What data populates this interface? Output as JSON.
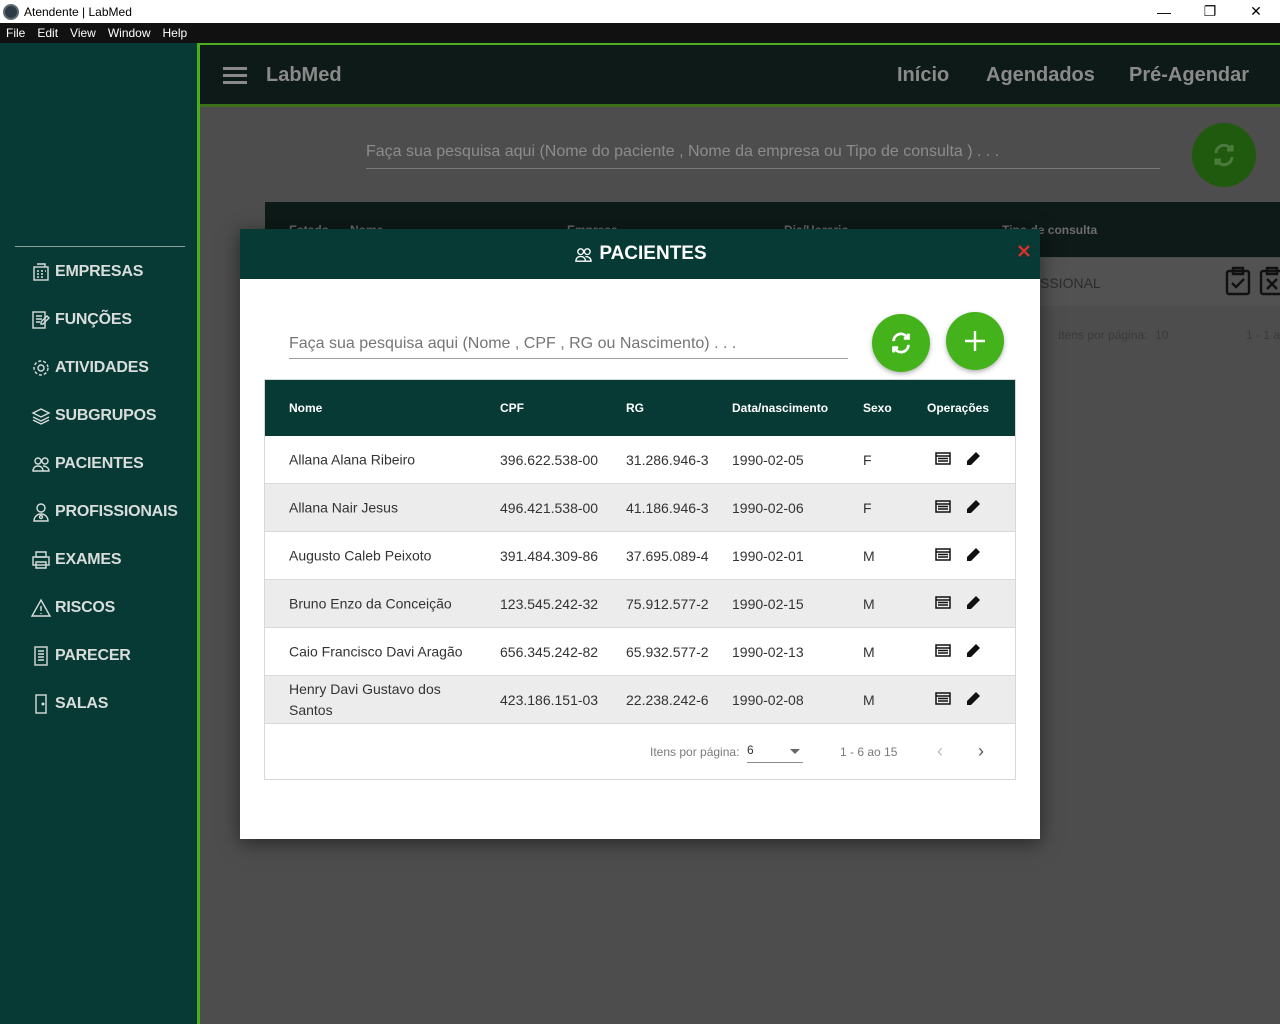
{
  "window": {
    "title": "Atendente | LabMed",
    "minimize": "—",
    "maximize": "❐",
    "close": "✕"
  },
  "menubar": [
    "File",
    "Edit",
    "View",
    "Window",
    "Help"
  ],
  "sidebar": {
    "items": [
      {
        "label": "EMPRESAS",
        "icon": "building-icon"
      },
      {
        "label": "FUNÇÕES",
        "icon": "document-edit-icon"
      },
      {
        "label": "ATIVIDADES",
        "icon": "gear-icon"
      },
      {
        "label": "SUBGRUPOS",
        "icon": "layers-icon"
      },
      {
        "label": "PACIENTES",
        "icon": "users-icon"
      },
      {
        "label": "PROFISSIONAIS",
        "icon": "doctor-icon"
      },
      {
        "label": "EXAMES",
        "icon": "printer-icon"
      },
      {
        "label": "RISCOS",
        "icon": "warning-icon"
      },
      {
        "label": "PARECER",
        "icon": "clipboard-icon"
      },
      {
        "label": "SALAS",
        "icon": "door-icon"
      }
    ]
  },
  "header": {
    "brand": "LabMed",
    "nav": [
      "Início",
      "Agendados",
      "Pré-Agendar"
    ]
  },
  "background": {
    "search_placeholder": "Faça sua pesquisa aqui (Nome do paciente , Nome da empresa ou Tipo de consulta ) . . .",
    "columns": [
      "Estado",
      "Nome",
      "Empresa",
      "Dia/Horario",
      "Tipo de consulta"
    ],
    "row_text": "SSIONAL",
    "paginator_label": "Itens por página:",
    "paginator_value": "10",
    "paginator_range": "1 - 1 a"
  },
  "modal": {
    "title": "PACIENTES",
    "title_icon": "users-icon",
    "search_placeholder": "Faça sua pesquisa aqui (Nome , CPF , RG ou Nascimento) . . .",
    "columns": {
      "name": "Nome",
      "cpf": "CPF",
      "rg": "RG",
      "birth": "Data/nascimento",
      "sex": "Sexo",
      "ops": "Operações"
    },
    "rows": [
      {
        "name": "Allana Alana Ribeiro",
        "cpf": "396.622.538-00",
        "rg": "31.286.946-3",
        "birth": "1990-02-05",
        "sex": "F"
      },
      {
        "name": "Allana Nair Jesus",
        "cpf": "496.421.538-00",
        "rg": "41.186.946-3",
        "birth": "1990-02-06",
        "sex": "F"
      },
      {
        "name": "Augusto Caleb Peixoto",
        "cpf": "391.484.309-86",
        "rg": "37.695.089-4",
        "birth": "1990-02-01",
        "sex": "M"
      },
      {
        "name": "Bruno Enzo da Conceição",
        "cpf": "123.545.242-32",
        "rg": "75.912.577-2",
        "birth": "1990-02-15",
        "sex": "M"
      },
      {
        "name": "Caio Francisco Davi Aragão",
        "cpf": "656.345.242-82",
        "rg": "65.932.577-2",
        "birth": "1990-02-13",
        "sex": "M"
      },
      {
        "name": "Henry Davi Gustavo dos Santos",
        "cpf": "423.186.151-03",
        "rg": "22.238.242-6",
        "birth": "1990-02-08",
        "sex": "M"
      }
    ],
    "paginator": {
      "label": "Itens por página:",
      "page_size": "6",
      "range": "1 - 6 ao 15",
      "prev": "‹",
      "next": "›"
    }
  },
  "colors": {
    "primary_dark": "#073a34",
    "accent_green": "#44b21a",
    "close_red": "#d9302a"
  }
}
